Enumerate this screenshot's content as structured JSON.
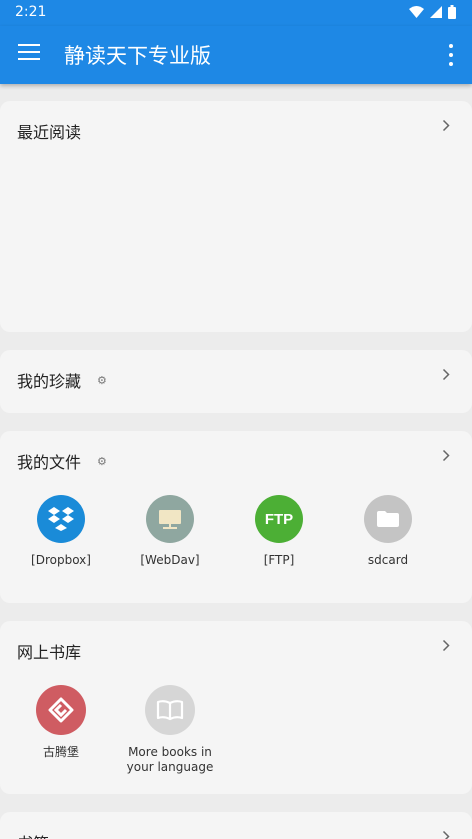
{
  "status": {
    "time": "2:21"
  },
  "appbar": {
    "title": "静读天下专业版"
  },
  "sections": {
    "recent": {
      "title": "最近阅读"
    },
    "favorites": {
      "title": "我的珍藏"
    },
    "files": {
      "title": "我的文件",
      "items": [
        {
          "label": "[Dropbox]",
          "icon": "dropbox-icon",
          "color": "#1a8bd8"
        },
        {
          "label": "[WebDav]",
          "icon": "webdav-icon",
          "color": "#8fa7a0"
        },
        {
          "label": "[FTP]",
          "icon": "ftp-icon",
          "color": "#4caf35",
          "icon_text": "FTP"
        },
        {
          "label": "sdcard",
          "icon": "folder-icon",
          "color": "#c4c4c4"
        }
      ]
    },
    "online": {
      "title": "网上书库",
      "items": [
        {
          "label": "古腾堡",
          "icon": "gutenberg-icon",
          "color": "#cf5c62"
        },
        {
          "label": "More books in your language",
          "icon": "book-icon",
          "color": "#d6d6d6"
        }
      ]
    },
    "bookmarks": {
      "title": "书签"
    }
  }
}
